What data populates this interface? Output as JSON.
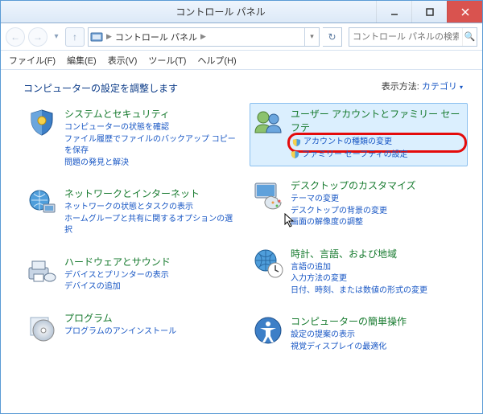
{
  "window": {
    "title": "コントロール パネル"
  },
  "addr": {
    "location": "コントロール パネル",
    "search_placeholder": "コントロール パネルの検索"
  },
  "menu": {
    "file": "ファイル(F)",
    "edit": "編集(E)",
    "view": "表示(V)",
    "tools": "ツール(T)",
    "help": "ヘルプ(H)"
  },
  "heading": "コンピューターの設定を調整します",
  "viewmode": {
    "label": "表示方法:",
    "value": "カテゴリ"
  },
  "cats": {
    "system": {
      "title": "システムとセキュリティ",
      "links": [
        "コンピューターの状態を確認",
        "ファイル履歴でファイルのバックアップ コピーを保存",
        "問題の発見と解決"
      ]
    },
    "network": {
      "title": "ネットワークとインターネット",
      "links": [
        "ネットワークの状態とタスクの表示",
        "ホームグループと共有に関するオプションの選択"
      ]
    },
    "hardware": {
      "title": "ハードウェアとサウンド",
      "links": [
        "デバイスとプリンターの表示",
        "デバイスの追加"
      ]
    },
    "programs": {
      "title": "プログラム",
      "links": [
        "プログラムのアンインストール"
      ]
    },
    "users": {
      "title": "ユーザー アカウントとファミリー セーフテ",
      "links": [
        "アカウントの種類の変更",
        "ファミリー セーフティの設定"
      ]
    },
    "appearance": {
      "title": "デスクトップのカスタマイズ",
      "links": [
        "テーマの変更",
        "デスクトップの背景の変更",
        "画面の解像度の調整"
      ]
    },
    "clock": {
      "title": "時計、言語、および地域",
      "links": [
        "言語の追加",
        "入力方法の変更",
        "日付、時刻、または数値の形式の変更"
      ]
    },
    "ease": {
      "title": "コンピューターの簡単操作",
      "links": [
        "設定の提案の表示",
        "視覚ディスプレイの最適化"
      ]
    }
  }
}
